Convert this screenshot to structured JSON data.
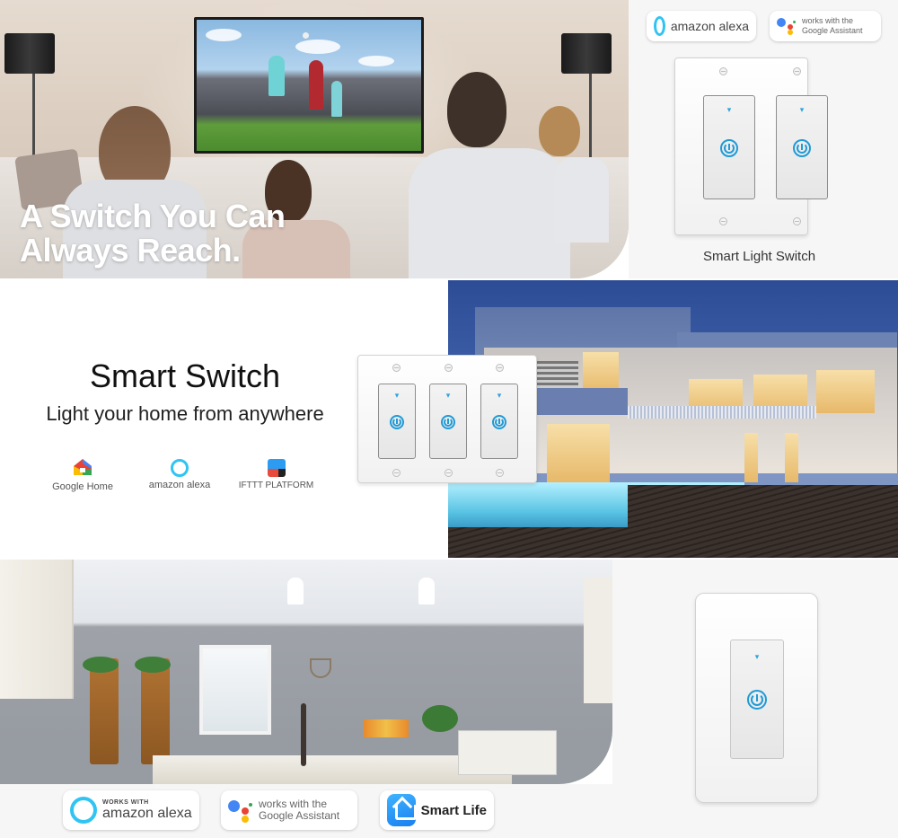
{
  "section1": {
    "headline_line1": "A Switch You Can",
    "headline_line2": "Always Reach.",
    "badges": {
      "alexa": "amazon alexa",
      "google_line1": "works with the",
      "google_line2": "Google Assistant"
    },
    "product_caption": "Smart Light Switch",
    "gang_count": 2
  },
  "section2": {
    "title": "Smart Switch",
    "subtitle": "Light your home from anywhere",
    "platforms": [
      {
        "label": "Google Home",
        "icon": "google-home-icon"
      },
      {
        "label": "amazon alexa",
        "icon": "alexa-icon"
      },
      {
        "label": "IFTTT PLATFORM",
        "icon": "ifttt-icon"
      }
    ],
    "gang_count": 3
  },
  "section3": {
    "badges": {
      "alexa_small": "WORKS WITH",
      "alexa": "amazon alexa",
      "google_line1": "works with the",
      "google_line2": "Google Assistant",
      "smartlife": "Smart Life"
    },
    "gang_count": 1
  },
  "colors": {
    "alexa_blue": "#31c4f3",
    "power_blue": "#1f9ad6",
    "google_blue": "#4285f4",
    "google_red": "#ea4335",
    "google_yellow": "#fbbc05",
    "google_green": "#34a853"
  }
}
